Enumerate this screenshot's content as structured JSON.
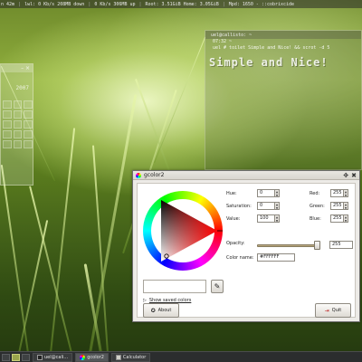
{
  "topbar": {
    "segments": [
      "n 42m",
      "lwl: 0 Kb/s 208MB down",
      "0 Kb/s 306MB up",
      "Root: 3.51GiB  Home: 3.05GiB",
      "Mpd: 1650 - ::cobrixcide"
    ]
  },
  "calculator_window": {
    "title_controls": "–  ×",
    "display": "2007"
  },
  "terminal": {
    "title": "uel@callisto: ~",
    "lines": [
      "07:32  ~",
      "uel # toilet Simple and Nice! && scrot -d 5"
    ],
    "banner": "Simple and Nice!"
  },
  "gcolor2": {
    "title": "gcolor2",
    "fields": {
      "hue": {
        "label": "Hue:",
        "value": "0"
      },
      "saturation": {
        "label": "Saturation:",
        "value": "0"
      },
      "value": {
        "label": "Value:",
        "value": "100"
      },
      "red": {
        "label": "Red:",
        "value": "255"
      },
      "green": {
        "label": "Green:",
        "value": "255"
      },
      "blue": {
        "label": "Blue:",
        "value": "255"
      },
      "opacity": {
        "label": "Opacity:",
        "value": "255"
      },
      "color_name": {
        "label": "Color name:",
        "value": "#FFFFFF"
      }
    },
    "show_saved": "Show saved colors",
    "about_label": "About",
    "quit_label": "Quit",
    "colors": {
      "triangle_hue": "#ff0000",
      "window_bg": "#edebe7"
    }
  },
  "taskbar": {
    "tasks": [
      {
        "label": "uel@cali…",
        "icon": "terminal-icon"
      },
      {
        "label": "gcolor2",
        "icon": "color-wheel-icon"
      },
      {
        "label": "Calculator",
        "icon": "calculator-icon"
      }
    ]
  }
}
